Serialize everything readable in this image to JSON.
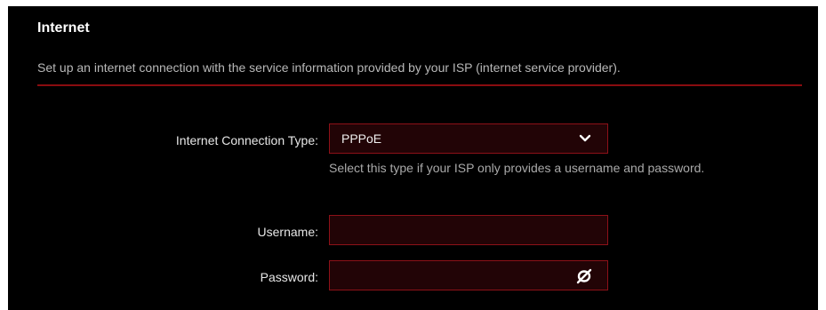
{
  "section": {
    "title": "Internet",
    "description": "Set up an internet connection with the service information provided by your ISP (internet service provider)."
  },
  "connection_type": {
    "label": "Internet Connection Type:",
    "selected": "PPPoE",
    "hint": "Select this type if your ISP only provides a username and password.",
    "icon": "chevron-down-icon"
  },
  "username": {
    "label": "Username:",
    "value": ""
  },
  "password": {
    "label": "Password:",
    "value": "",
    "icon": "eye-slash-icon"
  },
  "colors": {
    "background": "#000000",
    "accent": "#8a0c10",
    "field_background": "#220406",
    "field_border": "#8d1118"
  }
}
